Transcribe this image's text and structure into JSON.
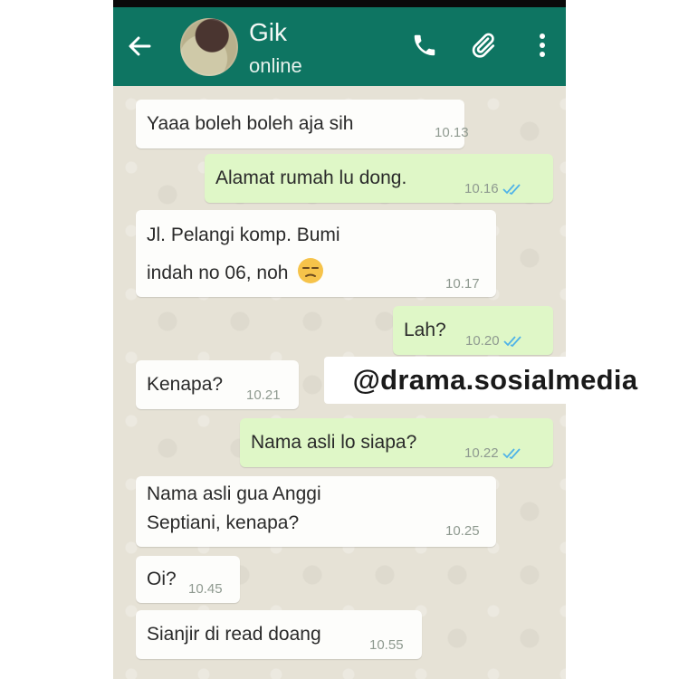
{
  "header": {
    "contact_name": "Gik",
    "contact_status": "online"
  },
  "messages": [
    {
      "direction": "incoming",
      "lines": [
        "Yaaa boleh boleh aja sih"
      ],
      "time": "10.13"
    },
    {
      "direction": "outgoing",
      "lines": [
        "Alamat rumah lu dong."
      ],
      "time": "10.16",
      "status": "read"
    },
    {
      "direction": "incoming",
      "lines": [
        "Jl. Pelangi komp. Bumi",
        "indah no 06, noh"
      ],
      "emoji": "unamused-face",
      "time": "10.17"
    },
    {
      "direction": "outgoing",
      "lines": [
        "Lah?"
      ],
      "time": "10.20",
      "status": "read"
    },
    {
      "direction": "incoming",
      "lines": [
        "Kenapa?"
      ],
      "time": "10.21"
    },
    {
      "direction": "outgoing",
      "lines": [
        "Nama asli lo siapa?"
      ],
      "time": "10.22",
      "status": "read"
    },
    {
      "direction": "incoming",
      "lines": [
        "Nama asli gua Anggi",
        "Septiani, kenapa?"
      ],
      "time": "10.25"
    },
    {
      "direction": "incoming",
      "lines": [
        "Oi?"
      ],
      "time": "10.45"
    },
    {
      "direction": "incoming",
      "lines": [
        "Sianjir di read doang"
      ],
      "time": "10.55"
    }
  ],
  "watermark": "@drama.sosialmedia",
  "colors": {
    "header": "#0e7562",
    "incoming_bubble": "#fdfdfb",
    "outgoing_bubble": "#dff7c7",
    "read_tick": "#4fb3e8",
    "chat_background": "#e6e2d6"
  }
}
